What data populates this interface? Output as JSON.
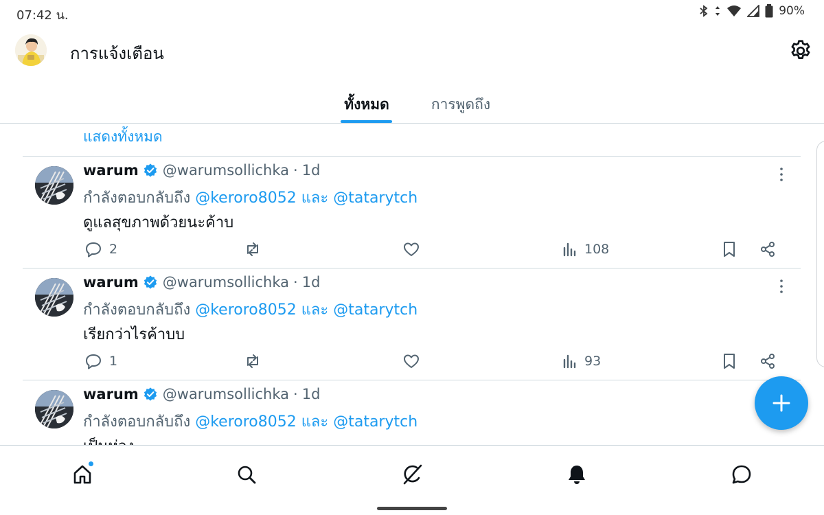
{
  "status_bar": {
    "time": "07:42 น.",
    "battery": "90%"
  },
  "header": {
    "title": "การแจ้งเตือน"
  },
  "tabs": [
    {
      "label": "ทั้งหมด",
      "active": true
    },
    {
      "label": "การพูดถึง",
      "active": false
    }
  ],
  "show_all_label": "แสดงทั้งหมด",
  "posts": [
    {
      "name": "warum",
      "handle": "@warumsollichka",
      "dot": "·",
      "time": "1d",
      "reply_prefix": "กำลังตอบกลับถึง",
      "mention_1": "@keroro8052",
      "conj": "และ",
      "mention_2": "@tatarytch",
      "text": "ดูแลสุขภาพด้วยนะค้าบ",
      "replies": "2",
      "views": "108"
    },
    {
      "name": "warum",
      "handle": "@warumsollichka",
      "dot": "·",
      "time": "1d",
      "reply_prefix": "กำลังตอบกลับถึง",
      "mention_1": "@keroro8052",
      "conj": "และ",
      "mention_2": "@tatarytch",
      "text": "เรียกว่าไรค้าบบ",
      "replies": "1",
      "views": "93"
    },
    {
      "name": "warum",
      "handle": "@warumsollichka",
      "dot": "·",
      "time": "1d",
      "reply_prefix": "กำลังตอบกลับถึง",
      "mention_1": "@keroro8052",
      "conj": "และ",
      "mention_2": "@tatarytch",
      "text": "เป็นห่วง"
    }
  ],
  "icons": {
    "settings": "gear-icon",
    "compose": "plus-icon",
    "nav": [
      "home-icon",
      "search-icon",
      "grok-icon",
      "bell-icon",
      "message-icon"
    ]
  },
  "colors": {
    "accent": "#1d9bf0",
    "text_primary": "#0f1419",
    "text_secondary": "#536471",
    "divider": "#cfd9de"
  }
}
